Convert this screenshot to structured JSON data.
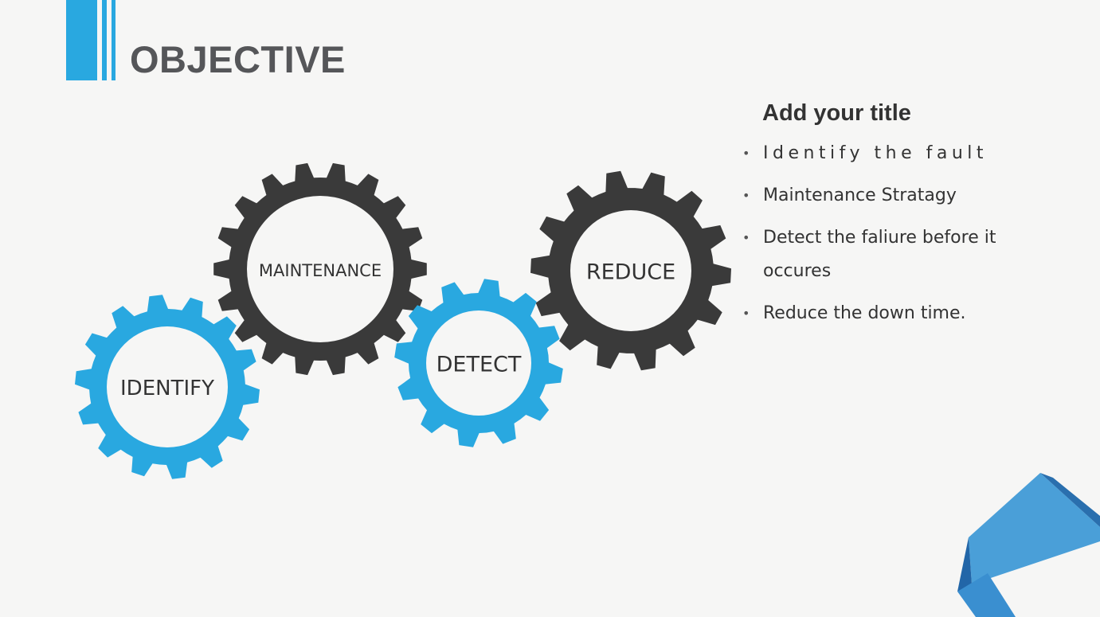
{
  "header": {
    "title": "OBJECTIVE",
    "accent_color": "#29a8e0"
  },
  "gears": [
    {
      "label": "IDENTIFY",
      "color": "#29a8e0",
      "teeth": 14
    },
    {
      "label": "MAINTENANCE",
      "color": "#3a3a3a",
      "teeth": 18
    },
    {
      "label": "DETECT",
      "color": "#29a8e0",
      "teeth": 12
    },
    {
      "label": "REDUCE",
      "color": "#3a3a3a",
      "teeth": 14
    }
  ],
  "info": {
    "title": "Add your title",
    "bullets": [
      "Identify the fault",
      "Maintenance Stratagy",
      "Detect the faliure before it occures",
      "Reduce the down time."
    ]
  },
  "colors": {
    "blue": "#29a8e0",
    "dark": "#3a3a3a",
    "text": "#333333",
    "corner_light": "#4a9fd8",
    "corner_dark": "#2266a8"
  }
}
